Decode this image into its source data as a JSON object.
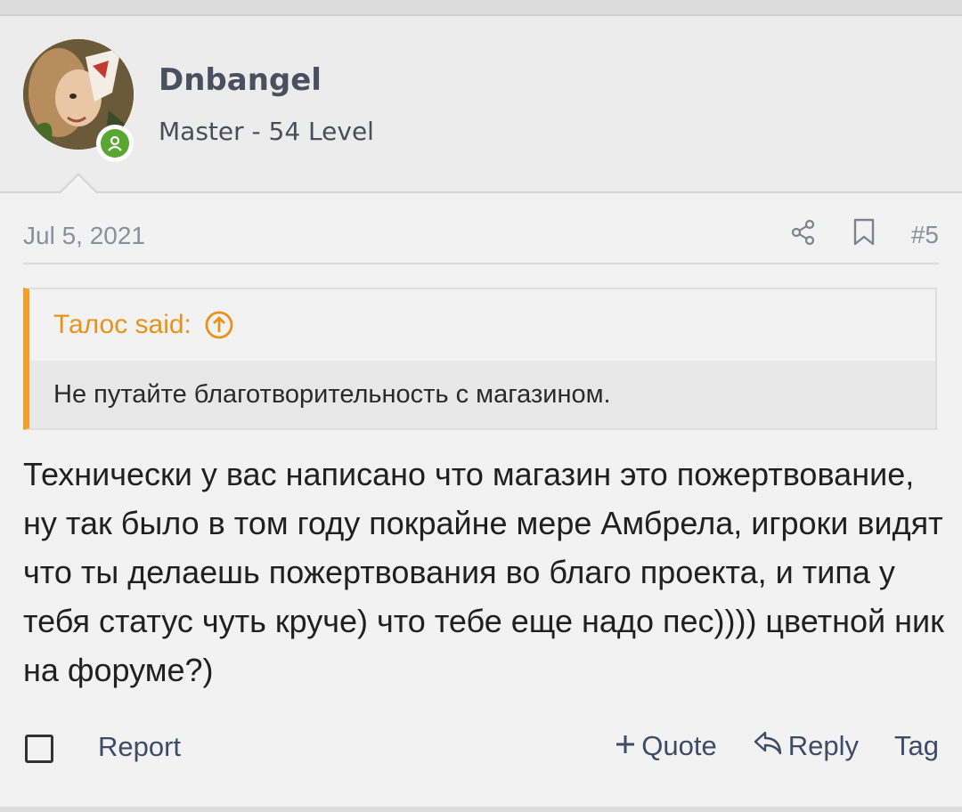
{
  "post": {
    "author": {
      "username": "Dnbangel",
      "title": "Master - 54 Level",
      "online": true
    },
    "date": "Jul 5, 2021",
    "number": "#5",
    "quote": {
      "author_said": "Талос said:",
      "text": "Не путайте благотворительность с магазином."
    },
    "message": "Технически у вас написано что магазин это пожертвование, ну так было в том году покрайне мере Амбрела, игроки видят что ты делаешь пожертвования во благо проекта, и типа у тебя статус чуть круче) что тебе еще надо пес)))) цветной ник на форуме?)"
  },
  "footer": {
    "report_label": "Report",
    "quote_label": "Quote",
    "reply_label": "Reply",
    "tag_label": "Tag"
  },
  "icons": {
    "share": "share-icon",
    "bookmark": "bookmark-icon",
    "quote_up": "arrow-up-circle-icon",
    "online": "user-online-icon",
    "plus": "plus-icon",
    "reply": "reply-arrow-icon"
  },
  "colors": {
    "quote_accent": "#f1a12a",
    "online_green": "#5aa632",
    "link": "#3d4c66",
    "muted": "#8a8f9b"
  }
}
